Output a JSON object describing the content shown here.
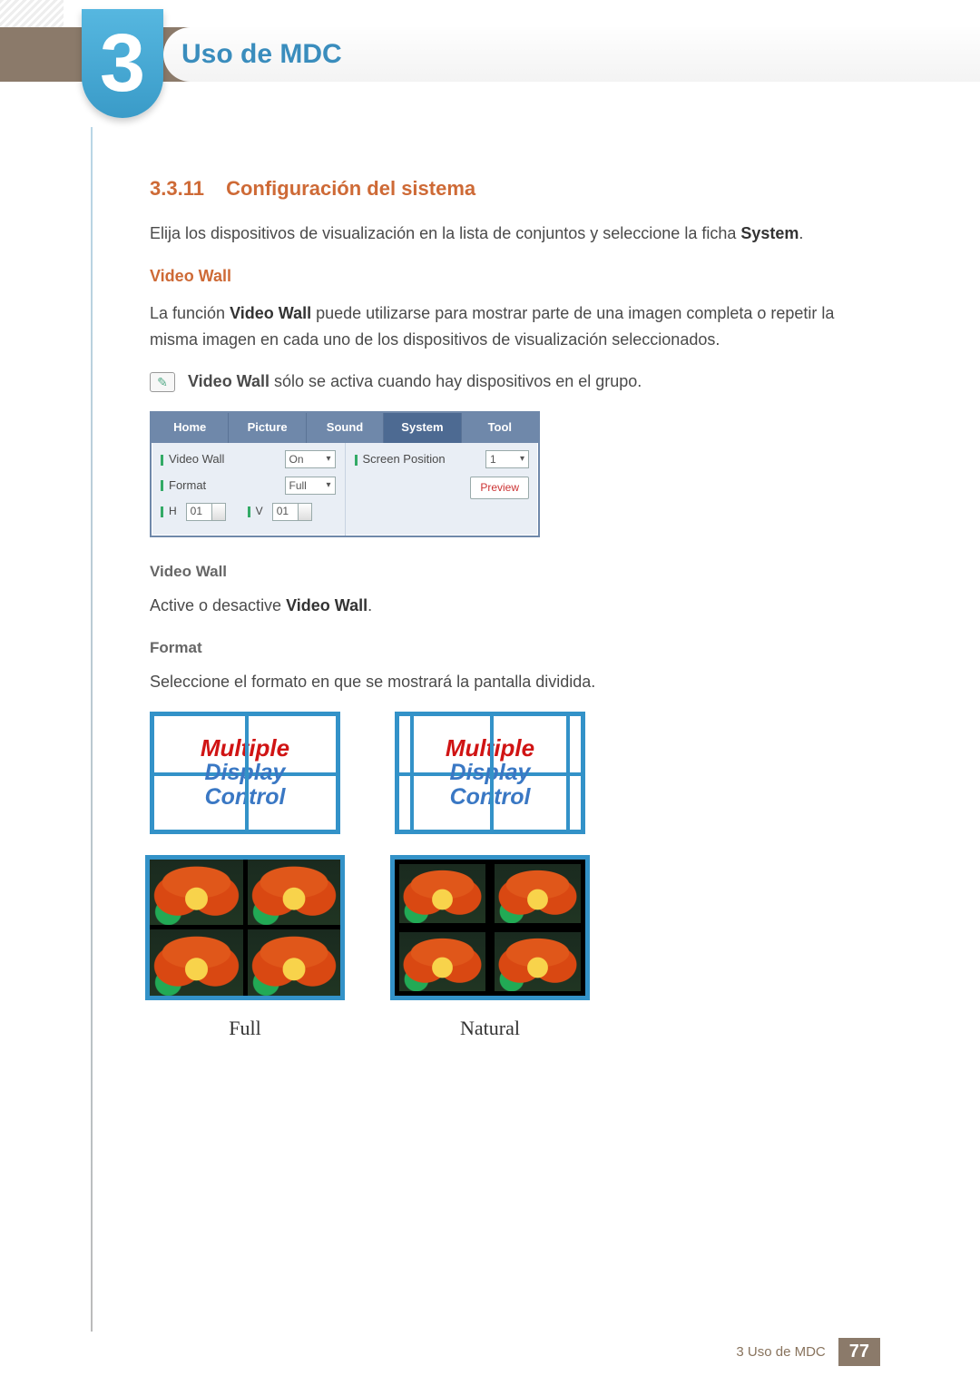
{
  "chapter_number": "3",
  "chapter_title": "Uso de MDC",
  "section": {
    "number": "3.3.11",
    "title": "Configuración del sistema"
  },
  "intro_para_pre": "Elija los dispositivos de visualización en la lista de conjuntos y seleccione la ficha ",
  "intro_para_bold": "System",
  "intro_para_post": ".",
  "sub_videowall": "Video Wall",
  "vw_para_pre": "La función ",
  "vw_para_bold": "Video Wall",
  "vw_para_post": " puede utilizarse para mostrar parte de una imagen completa o repetir la misma imagen en cada uno de los dispositivos de visualización seleccionados.",
  "note_bold": "Video Wall",
  "note_rest": " sólo se activa cuando hay dispositivos en el grupo.",
  "ui": {
    "tabs": {
      "home": "Home",
      "picture": "Picture",
      "sound": "Sound",
      "system": "System",
      "tool": "Tool"
    },
    "videowall_label": "Video Wall",
    "videowall_value": "On",
    "format_label": "Format",
    "format_value": "Full",
    "h_label": "H",
    "h_value": "01",
    "v_label": "V",
    "v_value": "01",
    "screenpos_label": "Screen Position",
    "screenpos_value": "1",
    "preview_label": "Preview"
  },
  "heading_videowall": "Video Wall",
  "videowall_toggle_pre": "Active o desactive ",
  "videowall_toggle_bold": "Video Wall",
  "videowall_toggle_post": ".",
  "heading_format": "Format",
  "format_para": "Seleccione el formato en que se mostrará la pantalla dividida.",
  "logo": {
    "line1": "Multiple",
    "line2": "Display",
    "line3": "Control"
  },
  "caption_full": "Full",
  "caption_natural": "Natural",
  "footer_text": "3 Uso de MDC",
  "page_number": "77"
}
